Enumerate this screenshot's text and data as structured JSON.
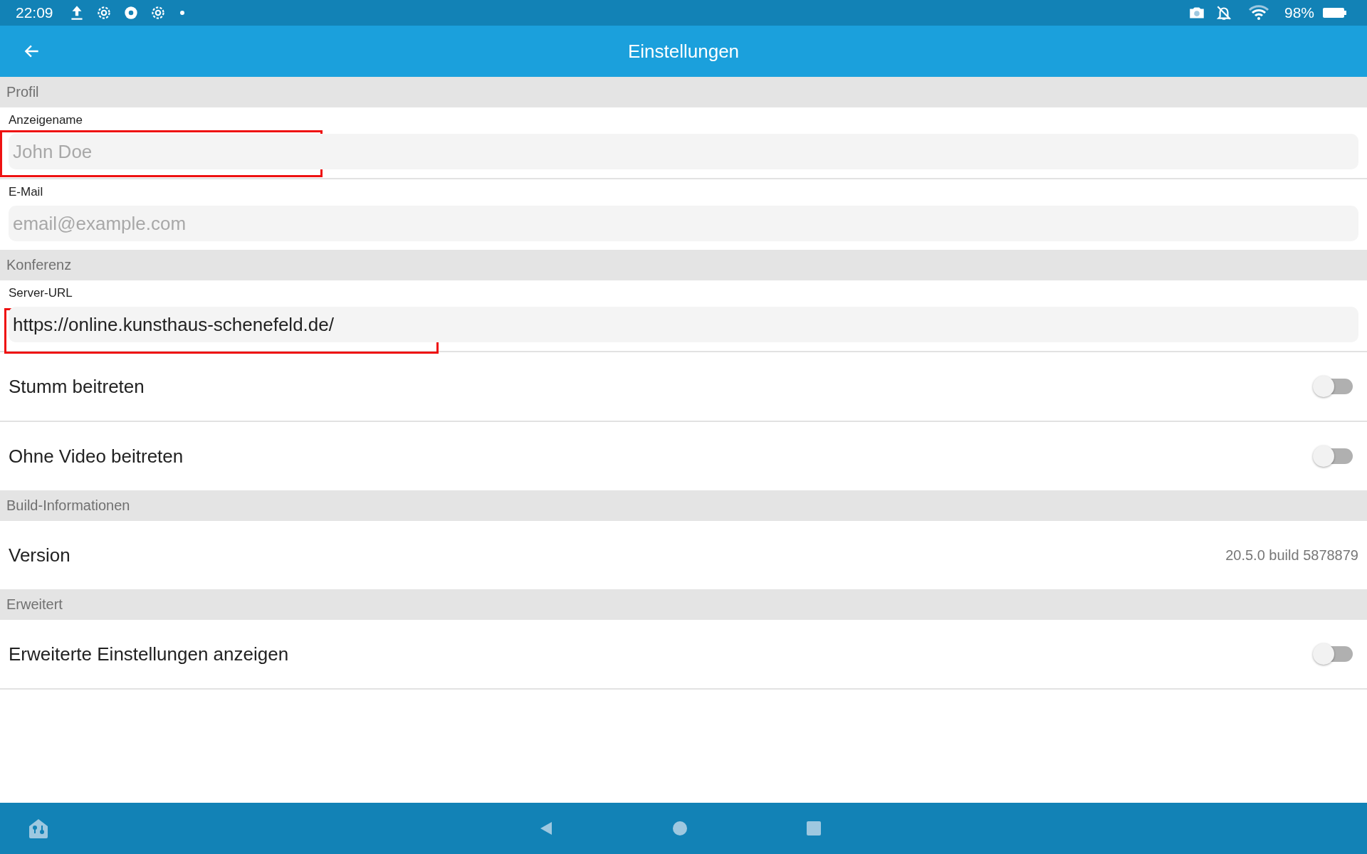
{
  "status_bar": {
    "time": "22:09",
    "battery": "98%"
  },
  "app_bar": {
    "title": "Einstellungen"
  },
  "sections": [
    {
      "title": "Profil",
      "items": [
        {
          "kind": "field",
          "label": "Anzeigename",
          "placeholder": "John Doe",
          "highlighted": true
        },
        {
          "kind": "field",
          "label": "E-Mail",
          "placeholder": "email@example.com",
          "highlighted": false
        }
      ]
    },
    {
      "title": "Konferenz",
      "items": [
        {
          "kind": "field",
          "label": "Server-URL",
          "value": "https://online.kunsthaus-schenefeld.de/",
          "highlighted": true
        },
        {
          "kind": "switch",
          "label": "Stumm beitreten",
          "on": false
        },
        {
          "kind": "switch",
          "label": "Ohne Video beitreten",
          "on": false
        }
      ]
    },
    {
      "title": "Build-Informationen",
      "items": [
        {
          "kind": "info",
          "label": "Version",
          "value": "20.5.0 build 5878879"
        }
      ]
    },
    {
      "title": "Erweitert",
      "items": [
        {
          "kind": "switch",
          "label": "Erweiterte Einstellungen anzeigen",
          "on": false
        }
      ]
    }
  ]
}
